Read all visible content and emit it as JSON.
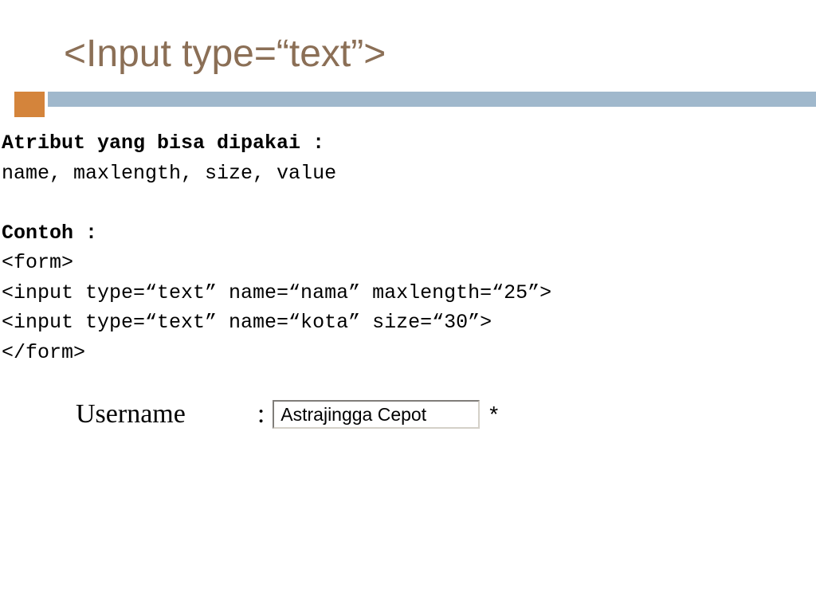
{
  "title": "<Input type=“text”>",
  "attrLabel": "Atribut yang bisa dipakai :",
  "attrList": "name, maxlength, size, value",
  "contohLabel": "Contoh :",
  "code1": "<form>",
  "code2": " <input type=“text” name=“nama” maxlength=“25”>",
  "code3": " <input type=“text” name=“kota” size=“30”>",
  "code4": "</form>",
  "exampleLabel": "Username",
  "exampleColon": ":",
  "exampleValue": "Astrajingga Cepot",
  "exampleAsterisk": "*"
}
